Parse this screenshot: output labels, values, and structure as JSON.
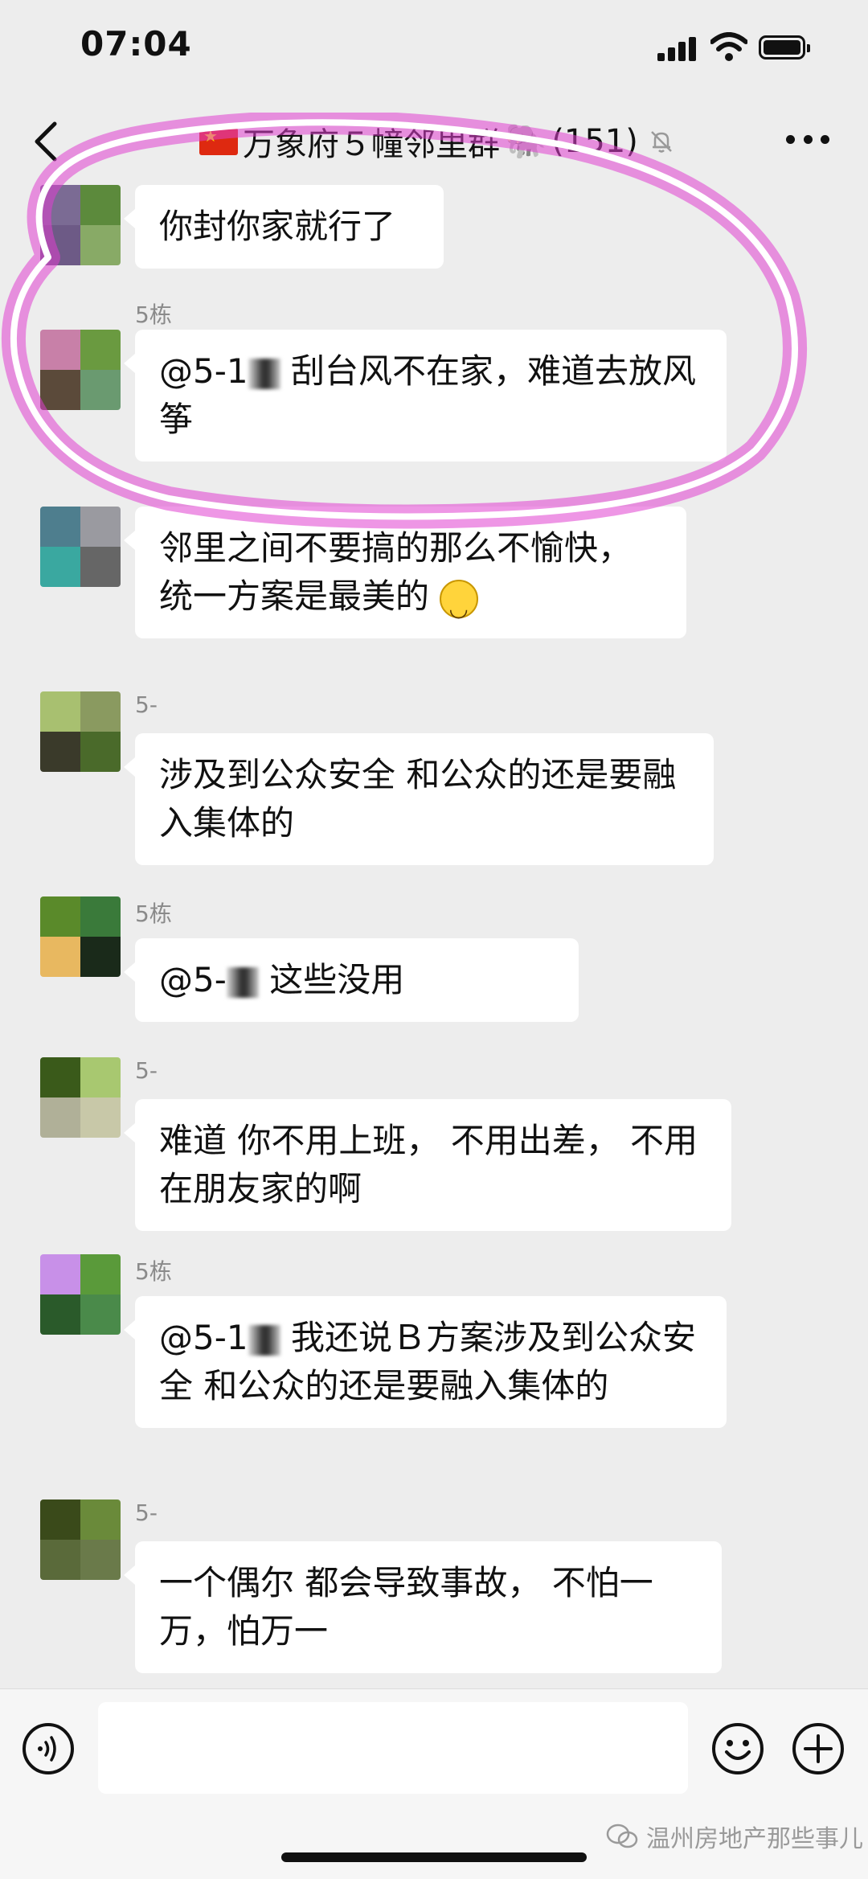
{
  "status_bar": {
    "time": "07:04"
  },
  "header": {
    "title": "万象府５幢邻里群",
    "member_count": "(151)"
  },
  "messages": [
    {
      "sender": "",
      "text": "你封你家就行了"
    },
    {
      "sender": "5栋",
      "mention": "@5-1",
      "text": "刮台风不在家，难道去放风筝"
    },
    {
      "sender": "",
      "text": "邻里之间不要搞的那么不愉快，统一方案是最美的"
    },
    {
      "sender": "5-",
      "text": "涉及到公众安全 和公众的还是要融入集体的"
    },
    {
      "sender": "5栋",
      "mention": "@5-",
      "text": "这些没用"
    },
    {
      "sender": "5-",
      "text": "难道 你不用上班， 不用出差， 不用在朋友家的啊"
    },
    {
      "sender": "5栋",
      "mention": "@5-1",
      "text": "我还说Ｂ方案涉及到公众安全 和公众的还是要融入集体的"
    },
    {
      "sender": "5-",
      "text": "一个偶尔 都会导致事故， 不怕一万，怕万一"
    }
  ],
  "watermark": "温州房地产那些事儿",
  "colors": {
    "highlight": "#e040d0",
    "background": "#ededed",
    "bubble": "#ffffff"
  }
}
